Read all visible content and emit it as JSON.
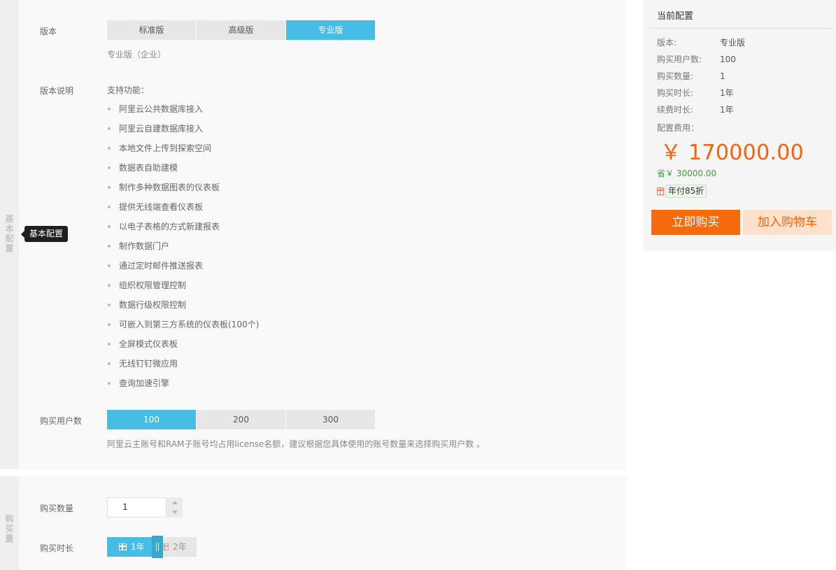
{
  "basic": {
    "side_tab": "基本配置",
    "tooltip": "基本配置",
    "version": {
      "label": "版本",
      "options": [
        "标准版",
        "高级版",
        "专业版"
      ],
      "selected": "专业版",
      "sub_note": "专业版（企业）"
    },
    "features": {
      "label": "版本说明",
      "heading": "支持功能：",
      "items": [
        "阿里云公共数据库接入",
        "阿里云自建数据库接入",
        "本地文件上传到探索空间",
        "数据表自助建模",
        "制作多种数据图表的仪表板",
        "提供无线端查看仪表板",
        "以电子表格的方式新建报表",
        "制作数据门户",
        "通过定时邮件推送报表",
        "组织权限管理控制",
        "数据行级权限控制",
        "可嵌入到第三方系统的仪表板(100个)",
        "全屏模式仪表板",
        "无线钉钉微应用",
        "查询加速引擎"
      ]
    },
    "users": {
      "label": "购买用户数",
      "options": [
        "100",
        "200",
        "300"
      ],
      "selected": "100",
      "note": "阿里云主账号和RAM子账号均占用license名额，建议根据您具体使用的账号数量来选择购买用户数 。"
    }
  },
  "quantity": {
    "side_tab": "购买量",
    "count_label": "购买数量",
    "count_value": "1",
    "duration_label": "购买时长",
    "duration_options": [
      "1年",
      "2年"
    ],
    "duration_selected": "1年"
  },
  "summary": {
    "title": "当前配置",
    "rows": [
      {
        "k": "版本:",
        "v": "专业版"
      },
      {
        "k": "购买用户数:",
        "v": "100"
      },
      {
        "k": "购买数量:",
        "v": "1"
      },
      {
        "k": "购买时长:",
        "v": "1年"
      },
      {
        "k": "续费时长:",
        "v": "1年"
      }
    ],
    "fee_label": "配置费用：",
    "price": "￥ 170000.00",
    "save": "省￥ 30000.00",
    "discount_badge": "年付85折",
    "buy_button": "立即购买",
    "cart_button": "加入购物车"
  },
  "colors": {
    "accent_blue": "#46bde5",
    "price_orange": "#f5620a",
    "save_green": "#3e9a3e"
  }
}
